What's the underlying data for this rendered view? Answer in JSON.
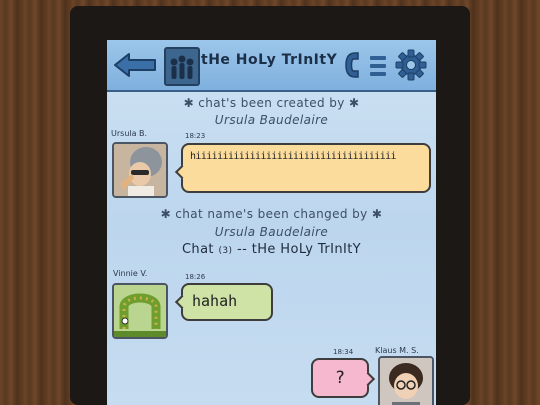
{
  "header": {
    "title": "tHe HoLy TrInItY",
    "back_icon": "back-arrow-icon",
    "group_icon": "group-people-icon",
    "phone_icon": "phone-icon",
    "menu_icon": "menu-icon",
    "settings_icon": "gear-icon"
  },
  "system_messages": {
    "created_label": "✱ chat's been created by ✱",
    "created_by": "Ursula Baudelaire",
    "renamed_label": "✱ chat name's been changed by ✱",
    "renamed_by": "Ursula Baudelaire",
    "new_name_prefix": "Chat",
    "new_name_count": "(3)",
    "new_name_rest": "-- tHe HoLy TrInItY"
  },
  "messages": [
    {
      "sender": "Ursula B.",
      "time": "18:23",
      "text": "hiiiiiiiiiiiiiiiiiiiiiiiiiiiiiiiiiiiii",
      "color": "#fbdc9c"
    },
    {
      "sender": "Vinnie V.",
      "time": "18:26",
      "text": "hahah",
      "color": "#cfe3a6"
    },
    {
      "sender": "Klaus M. S.",
      "time": "18:34",
      "text": "?",
      "color": "#f6b8cf"
    }
  ],
  "colors": {
    "header": "#8bb9e3",
    "screen": "#c5dbef",
    "wood": "#5e3d22"
  }
}
